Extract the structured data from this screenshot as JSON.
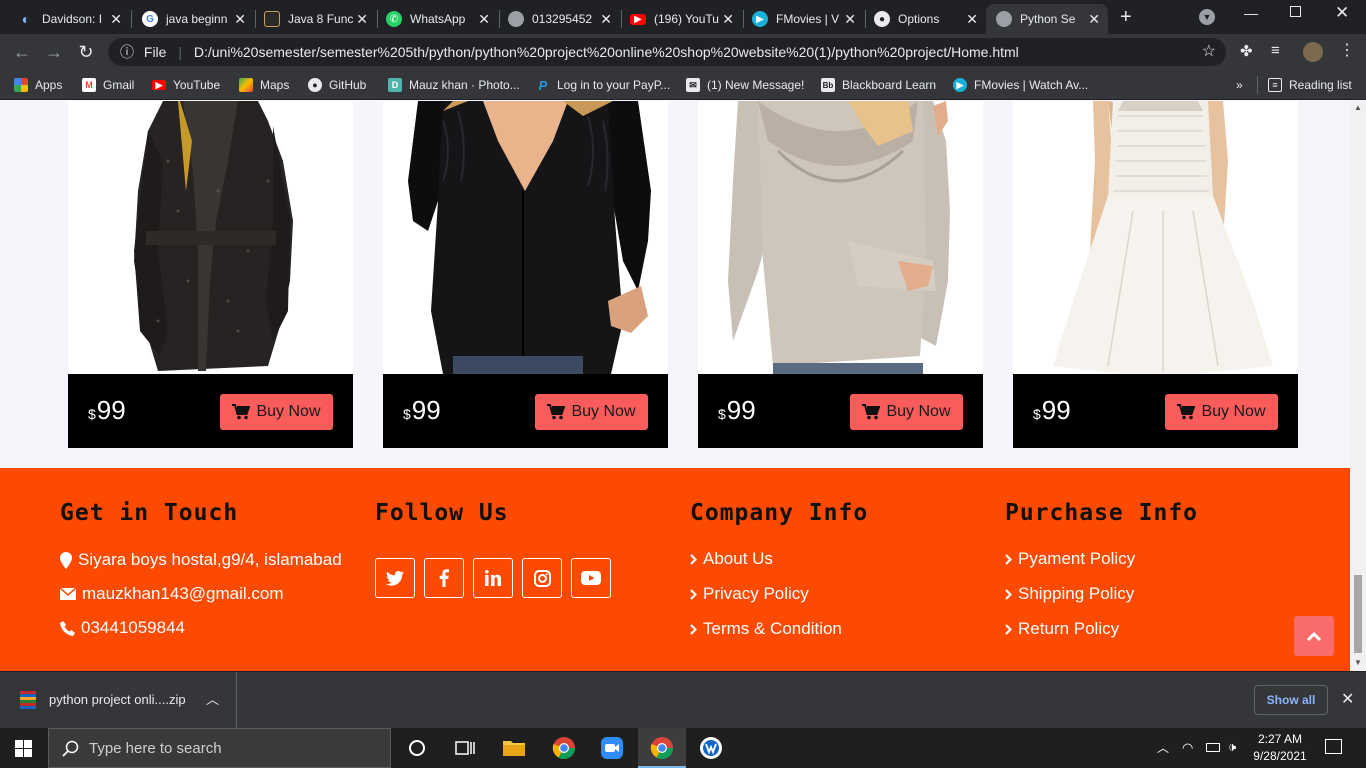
{
  "browser": {
    "tabs": [
      {
        "title": "Davidson: I",
        "favicon": "davidson-icon"
      },
      {
        "title": "java beginn",
        "favicon": "google-icon"
      },
      {
        "title": "Java 8 Func",
        "favicon": "tutorial-icon"
      },
      {
        "title": "WhatsApp",
        "favicon": "whatsapp-icon"
      },
      {
        "title": "013295452",
        "favicon": "globe-icon"
      },
      {
        "title": "(196) YouTu",
        "favicon": "youtube-icon"
      },
      {
        "title": "FMovies | V",
        "favicon": "fmovies-icon"
      },
      {
        "title": "Options",
        "favicon": "github-icon"
      },
      {
        "title": "Python Ser",
        "favicon": "globe-icon"
      }
    ],
    "address": {
      "scheme_label": "File",
      "url": "D:/uni%20semester/semester%205th/python/python%20project%20online%20shop%20website%20(1)/python%20project/Home.html"
    },
    "bookmarks": [
      {
        "label": "Apps",
        "icon": "apps-icon"
      },
      {
        "label": "Gmail",
        "icon": "gmail-icon"
      },
      {
        "label": "YouTube",
        "icon": "youtube-icon"
      },
      {
        "label": "Maps",
        "icon": "maps-icon"
      },
      {
        "label": "GitHub",
        "icon": "github-icon"
      },
      {
        "label": "Mauz khan · Photo...",
        "icon": "photo-icon"
      },
      {
        "label": "Log in to your PayP...",
        "icon": "paypal-icon"
      },
      {
        "label": "(1) New Message!",
        "icon": "message-icon"
      },
      {
        "label": "Blackboard Learn",
        "icon": "blackboard-icon"
      },
      {
        "label": "FMovies | Watch Av...",
        "icon": "fmovies-icon"
      }
    ],
    "reading_list": "Reading list",
    "more_bookmarks": "»"
  },
  "products": [
    {
      "currency": "$",
      "price": "99",
      "button": "Buy Now",
      "image": "dark-knit-coat"
    },
    {
      "currency": "$",
      "price": "99",
      "button": "Buy Now",
      "image": "black-lace-blouse"
    },
    {
      "currency": "$",
      "price": "99",
      "button": "Buy Now",
      "image": "beige-cowl-sweater"
    },
    {
      "currency": "$",
      "price": "99",
      "button": "Buy Now",
      "image": "white-summer-dress"
    }
  ],
  "footer": {
    "contact": {
      "heading": "Get in Touch",
      "address": "Siyara boys hostal,g9/4, islamabad",
      "email": "mauzkhan143@gmail.com",
      "phone": "03441059844"
    },
    "follow": {
      "heading": "Follow Us",
      "networks": [
        "twitter-icon",
        "facebook-icon",
        "linkedin-icon",
        "instagram-icon",
        "youtube-icon"
      ]
    },
    "company": {
      "heading": "Company Info",
      "links": [
        "About Us",
        "Privacy Policy",
        "Terms & Condition"
      ]
    },
    "purchase": {
      "heading": "Purchase Info",
      "links": [
        "Pyament Policy",
        "Shipping Policy",
        "Return Policy"
      ]
    }
  },
  "downloads": {
    "file": "python project onli....zip",
    "show_all": "Show all"
  },
  "taskbar": {
    "search_placeholder": "Type here to search",
    "time": "2:27 AM",
    "date": "9/28/2021"
  },
  "colors": {
    "footer_bg": "#fd4a02",
    "buy_button": "#fa5c5c",
    "price_bar": "#000000"
  }
}
